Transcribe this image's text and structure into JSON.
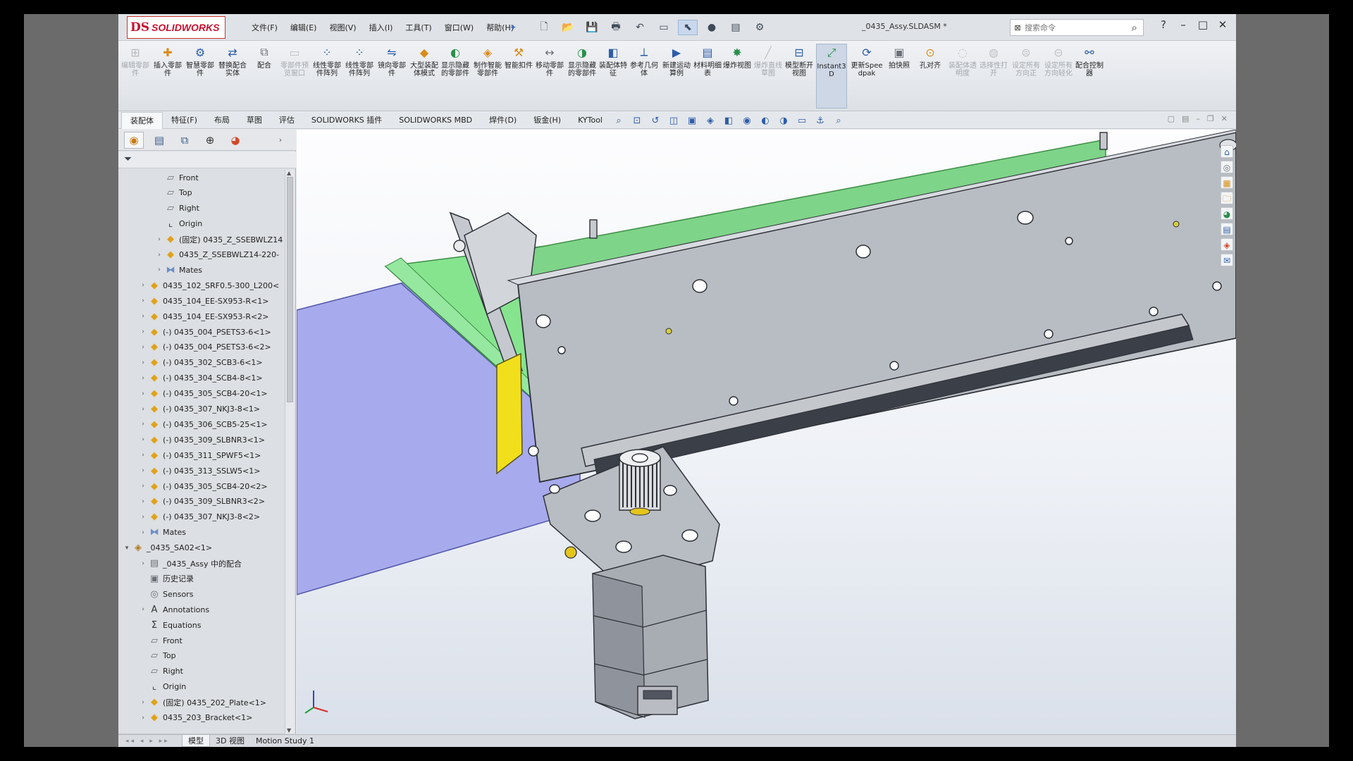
{
  "app": {
    "logo_mark": "DS",
    "logo_word": "SOLIDWORKS",
    "document_title": "_0435_Assy.SLDASM *"
  },
  "menu": [
    "文件(F)",
    "编辑(E)",
    "视图(V)",
    "插入(I)",
    "工具(T)",
    "窗口(W)",
    "帮助(H)"
  ],
  "search": {
    "placeholder": "搜索命令"
  },
  "command_manager": [
    {
      "label": "编辑零部件",
      "dim": true
    },
    {
      "label": "插入零部件",
      "dim": false
    },
    {
      "label": "智慧零部件",
      "dim": false
    },
    {
      "label": "替换配合实体",
      "dim": false
    },
    {
      "label": "配合",
      "dim": false
    },
    {
      "label": "零部件预览窗口",
      "dim": true
    },
    {
      "label": "线性零部件阵列",
      "dim": false
    },
    {
      "label": "线性零部件阵列",
      "dim": false
    },
    {
      "label": "镜向零部件",
      "dim": false
    },
    {
      "label": "大型装配体模式",
      "dim": false
    },
    {
      "label": "显示隐藏的零部件",
      "dim": false
    },
    {
      "label": "制作智能零部件",
      "dim": false
    },
    {
      "label": "智能扣件",
      "dim": false
    },
    {
      "label": "移动零部件",
      "dim": false
    },
    {
      "label": "显示隐藏的零部件",
      "dim": false
    },
    {
      "label": "装配体特征",
      "dim": false
    },
    {
      "label": "参考几何体",
      "dim": false
    },
    {
      "label": "新建运动算例",
      "dim": false
    },
    {
      "label": "材料明细表",
      "dim": false
    },
    {
      "label": "爆炸视图",
      "dim": false
    },
    {
      "label": "爆炸直线草图",
      "dim": true
    },
    {
      "label": "模型断开视图",
      "dim": false
    },
    {
      "label": "Instant3D",
      "dim": false,
      "active": true
    },
    {
      "label": "更新Speedpak",
      "dim": false
    },
    {
      "label": "拍快照",
      "dim": false
    },
    {
      "label": "孔对齐",
      "dim": false
    },
    {
      "label": "装配体透明度",
      "dim": true
    },
    {
      "label": "选择性打开",
      "dim": true
    },
    {
      "label": "设定所有方向正",
      "dim": true
    },
    {
      "label": "设定所有方向轻化",
      "dim": true
    },
    {
      "label": "配合控制器",
      "dim": false
    }
  ],
  "tabs": [
    "装配体",
    "特征(F)",
    "布局",
    "草图",
    "评估",
    "SOLIDWORKS 插件",
    "SOLIDWORKS MBD",
    "焊件(D)",
    "钣金(H)",
    "KYTool"
  ],
  "active_tab": "装配体",
  "tree": [
    {
      "text": "Front",
      "icon": "plane-icon",
      "indent": 2,
      "expand": false
    },
    {
      "text": "Top",
      "icon": "plane-icon",
      "indent": 2,
      "expand": false
    },
    {
      "text": "Right",
      "icon": "plane-icon",
      "indent": 2,
      "expand": false
    },
    {
      "text": "Origin",
      "icon": "origin-icon",
      "indent": 2,
      "expand": false
    },
    {
      "text": "(固定) 0435_Z_SSEBWLZ14",
      "icon": "part-icon",
      "indent": 2,
      "expand": true
    },
    {
      "text": "0435_Z_SSEBWLZ14-220-",
      "icon": "part-icon",
      "indent": 2,
      "expand": true
    },
    {
      "text": "Mates",
      "icon": "mates-icon",
      "indent": 2,
      "expand": true
    },
    {
      "text": "0435_102_SRF0.5-300_L200<",
      "icon": "part-icon",
      "indent": 1,
      "expand": true
    },
    {
      "text": "0435_104_EE-SX953-R<1>",
      "icon": "part-icon",
      "indent": 1,
      "expand": true
    },
    {
      "text": "0435_104_EE-SX953-R<2>",
      "icon": "part-icon",
      "indent": 1,
      "expand": true
    },
    {
      "text": "(-) 0435_004_PSETS3-6<1>",
      "icon": "part-icon",
      "indent": 1,
      "expand": true
    },
    {
      "text": "(-) 0435_004_PSETS3-6<2>",
      "icon": "part-icon",
      "indent": 1,
      "expand": true
    },
    {
      "text": "(-) 0435_302_SCB3-6<1>",
      "icon": "part-icon",
      "indent": 1,
      "expand": true
    },
    {
      "text": "(-) 0435_304_SCB4-8<1>",
      "icon": "part-icon",
      "indent": 1,
      "expand": true
    },
    {
      "text": "(-) 0435_305_SCB4-20<1>",
      "icon": "part-icon",
      "indent": 1,
      "expand": true
    },
    {
      "text": "(-) 0435_307_NKJ3-8<1>",
      "icon": "part-icon",
      "indent": 1,
      "expand": true
    },
    {
      "text": "(-) 0435_306_SCB5-25<1>",
      "icon": "part-icon",
      "indent": 1,
      "expand": true
    },
    {
      "text": "(-) 0435_309_SLBNR3<1>",
      "icon": "part-icon",
      "indent": 1,
      "expand": true
    },
    {
      "text": "(-) 0435_311_SPWF5<1>",
      "icon": "part-icon",
      "indent": 1,
      "expand": true
    },
    {
      "text": "(-) 0435_313_SSLW5<1>",
      "icon": "part-icon",
      "indent": 1,
      "expand": true
    },
    {
      "text": "(-) 0435_305_SCB4-20<2>",
      "icon": "part-icon",
      "indent": 1,
      "expand": true
    },
    {
      "text": "(-) 0435_309_SLBNR3<2>",
      "icon": "part-icon",
      "indent": 1,
      "expand": true
    },
    {
      "text": "(-) 0435_307_NKJ3-8<2>",
      "icon": "part-icon",
      "indent": 1,
      "expand": true
    },
    {
      "text": "Mates",
      "icon": "mates-icon",
      "indent": 1,
      "expand": true
    },
    {
      "text": "_0435_SA02<1>",
      "icon": "assembly-icon",
      "indent": 0,
      "expand": "open"
    },
    {
      "text": "_0435_Assy 中的配合",
      "icon": "mates-folder-icon",
      "indent": 1,
      "expand": true
    },
    {
      "text": "历史记录",
      "icon": "history-icon",
      "indent": 1,
      "expand": false
    },
    {
      "text": "Sensors",
      "icon": "sensor-icon",
      "indent": 1,
      "expand": false
    },
    {
      "text": "Annotations",
      "icon": "annotation-icon",
      "indent": 1,
      "expand": true
    },
    {
      "text": "Equations",
      "icon": "equation-icon",
      "indent": 1,
      "expand": false
    },
    {
      "text": "Front",
      "icon": "plane-icon",
      "indent": 1,
      "expand": false
    },
    {
      "text": "Top",
      "icon": "plane-icon",
      "indent": 1,
      "expand": false
    },
    {
      "text": "Right",
      "icon": "plane-icon",
      "indent": 1,
      "expand": false
    },
    {
      "text": "Origin",
      "icon": "origin-icon",
      "indent": 1,
      "expand": false
    },
    {
      "text": "(固定) 0435_202_Plate<1>",
      "icon": "part-icon",
      "indent": 1,
      "expand": true
    },
    {
      "text": "0435_203_Bracket<1>",
      "icon": "part-icon",
      "indent": 1,
      "expand": true
    }
  ],
  "bottom_tabs": [
    "模型",
    "3D 视图",
    "Motion Study 1"
  ],
  "active_bottom_tab": "模型",
  "colors": {
    "accent": "#2d5da8",
    "brand": "#c8102e",
    "green_channel": "#7fe08a",
    "blue_panel": "#a8abea",
    "yellow_block": "#f2df1c",
    "plate": "#b8bcc3"
  }
}
